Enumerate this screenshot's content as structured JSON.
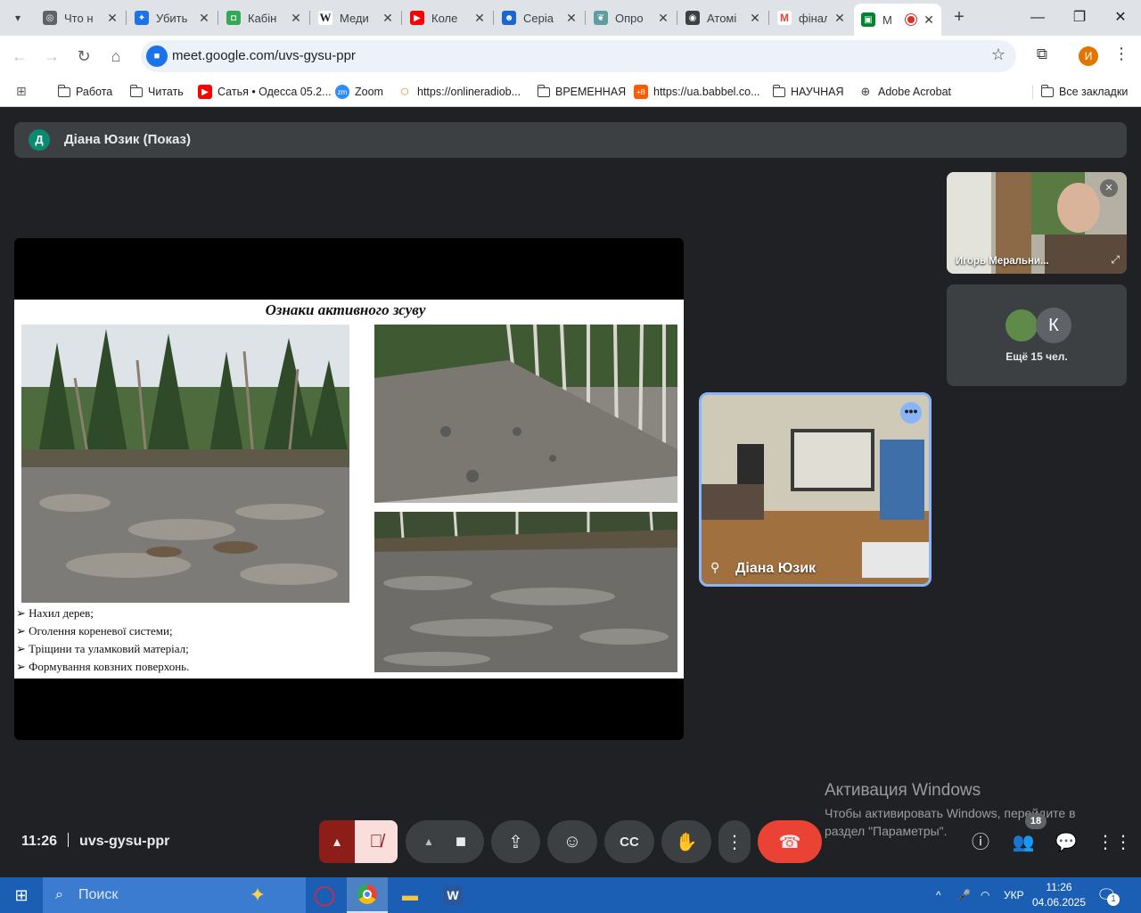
{
  "browser": {
    "tabs": [
      {
        "title": "Что н",
        "favicon": "chrome-icon",
        "color": "#5f6368"
      },
      {
        "title": "Убить",
        "favicon": "bird-icon",
        "color": "#1a73e8"
      },
      {
        "title": "Кабін",
        "favicon": "book-icon",
        "color": "#34a853"
      },
      {
        "title": "Меди",
        "favicon": "wikipedia-icon",
        "color": "#202124"
      },
      {
        "title": "Коле",
        "favicon": "youtube-icon",
        "color": "#ff0000"
      },
      {
        "title": "Серіа",
        "favicon": "mask-icon",
        "color": "#1967d2"
      },
      {
        "title": "Опро",
        "favicon": "leaf-icon",
        "color": "#5f9ea0"
      },
      {
        "title": "Атомі",
        "favicon": "radio-icon",
        "color": "#3c4043"
      },
      {
        "title": "фінал",
        "favicon": "gmail-icon",
        "color": "#ea4335"
      },
      {
        "title": "М",
        "favicon": "meet-icon",
        "color": "#00832d"
      }
    ],
    "address": {
      "url": "meet.google.com/uvs-gysu-ppr"
    },
    "profile_initial": "И",
    "bookmarks": [
      {
        "label": "Работа",
        "icon": "folder-icon"
      },
      {
        "label": "Читать",
        "icon": "folder-icon"
      },
      {
        "label": "Сатья • Одесса 05.2...",
        "icon": "youtube-icon"
      },
      {
        "label": "Zoom",
        "icon": "zoom-icon"
      },
      {
        "label": "https://onlineradiob...",
        "icon": "cube-icon"
      },
      {
        "label": "ВРЕМЕННАЯ",
        "icon": "folder-icon"
      },
      {
        "label": "https://ua.babbel.co...",
        "icon": "babbel-icon"
      },
      {
        "label": "НАУЧНАЯ",
        "icon": "folder-icon"
      },
      {
        "label": "Adobe Acrobat",
        "icon": "globe-icon"
      }
    ],
    "all_bookmarks_label": "Все закладки"
  },
  "meet": {
    "presenter_initial": "Д",
    "presenter_title": "Діана Юзик (Показ)",
    "slide": {
      "title": "Ознаки активного зсуву",
      "bullets": [
        "Нахил дерев;",
        "Оголення кореневої системи;",
        "Тріщини  та уламковий  матеріал;",
        " Формування  ковзних  поверхонь."
      ]
    },
    "self_tile_name": "Діана Юзик",
    "remote_tile_name": "Игорь Меральни...",
    "others_initial": "К",
    "others_label": "Ещё 15 чел.",
    "meeting_time": "11:26",
    "meeting_code": "uvs-gysu-ppr",
    "participants_count": "18"
  },
  "watermark": {
    "title": "Активация Windows",
    "body": "Чтобы активировать Windows, перейдите в раздел \"Параметры\"."
  },
  "taskbar": {
    "search_placeholder": "Поиск",
    "language": "УКР",
    "time": "11:26",
    "date": "04.06.2025",
    "notification_count": "1"
  }
}
